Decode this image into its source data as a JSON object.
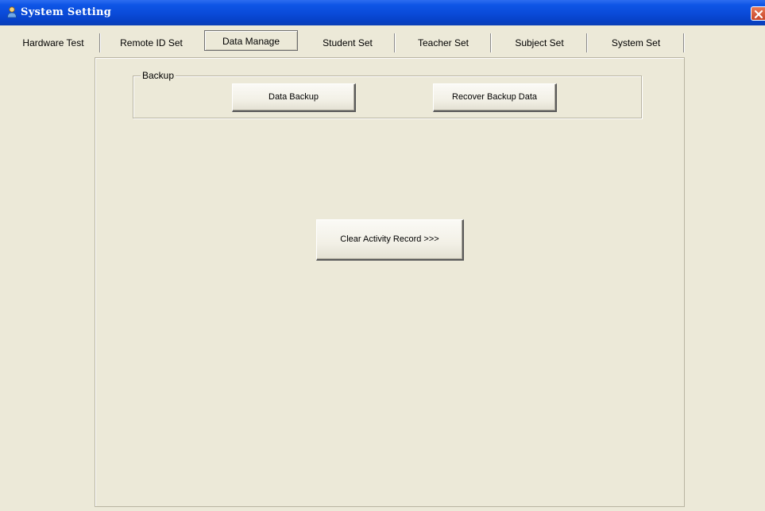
{
  "window": {
    "title": "System Setting",
    "close_icon": "close-icon",
    "app_icon": "user-icon"
  },
  "colors": {
    "titlebar": "#0a4ad8",
    "face": "#ece9d8",
    "close": "#d9532f"
  },
  "tabs": [
    {
      "label": "Hardware Test",
      "active": false
    },
    {
      "label": "Remote ID Set",
      "active": false
    },
    {
      "label": "Data Manage",
      "active": true
    },
    {
      "label": "Student Set",
      "active": false
    },
    {
      "label": "Teacher Set",
      "active": false
    },
    {
      "label": "Subject Set",
      "active": false
    },
    {
      "label": "System Set",
      "active": false
    }
  ],
  "backup_group": {
    "legend": "Backup",
    "data_backup_label": "Data Backup",
    "recover_label": "Recover Backup Data"
  },
  "clear_record_label": "Clear Activity Record >>>"
}
